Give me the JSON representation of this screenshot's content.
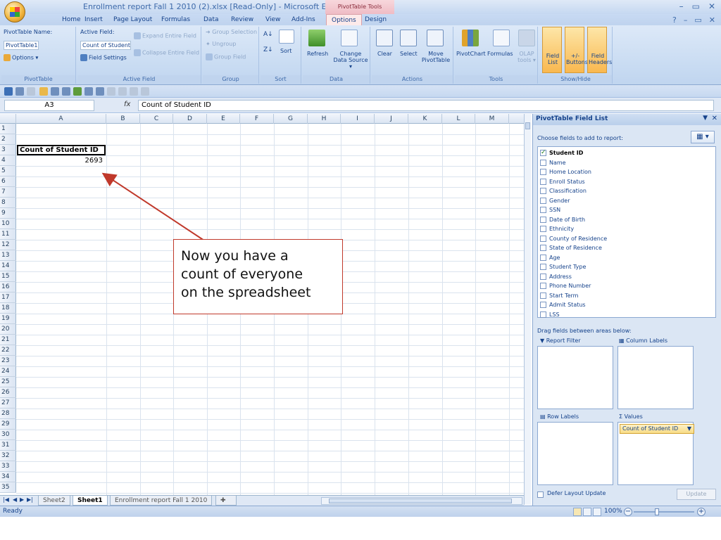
{
  "window": {
    "title": "Enrollment report Fall 1 2010 (2).xlsx  [Read-Only]  -  Microsoft Excel",
    "contextual_header": "PivotTable Tools",
    "controls": [
      "–",
      "▭",
      "✕"
    ],
    "mdi_controls": [
      "?",
      "–",
      "▭",
      "✕"
    ]
  },
  "tabs": [
    {
      "label": "Home"
    },
    {
      "label": "Insert"
    },
    {
      "label": "Page Layout"
    },
    {
      "label": "Formulas"
    },
    {
      "label": "Data"
    },
    {
      "label": "Review"
    },
    {
      "label": "View"
    },
    {
      "label": "Add-Ins"
    },
    {
      "label": "Options"
    },
    {
      "label": "Design"
    }
  ],
  "ribbon": {
    "pivottable": {
      "name_label": "PivotTable Name:",
      "name_value": "PivotTable1",
      "options_label": "Options ▾",
      "group_label": "PivotTable"
    },
    "active_field": {
      "label": "Active Field:",
      "value": "Count of Student",
      "settings_label": "Field Settings",
      "expand_label": "Expand Entire Field",
      "collapse_label": "Collapse Entire Field",
      "group_label": "Active Field"
    },
    "group": {
      "selection_label": "Group Selection",
      "ungroup_label": "Ungroup",
      "field_label": "Group Field",
      "group_label": "Group"
    },
    "sort": {
      "sort_label": "Sort",
      "group_label": "Sort"
    },
    "data": {
      "refresh_label": "Refresh",
      "change_source_label": "Change Data Source ▾",
      "group_label": "Data"
    },
    "actions": {
      "clear_label": "Clear",
      "select_label": "Select",
      "move_label": "Move PivotTable",
      "group_label": "Actions"
    },
    "tools": {
      "pivotchart_label": "PivotChart",
      "formulas_label": "Formulas",
      "olap_label": "OLAP tools ▾",
      "group_label": "Tools"
    },
    "show_hide": {
      "field_list_label": "Field List",
      "buttons_label": "+/- Buttons",
      "headers_label": "Field Headers",
      "group_label": "Show/Hide"
    }
  },
  "formula_bar": {
    "name_box": "A3",
    "fx": "fx",
    "formula": "Count of Student ID"
  },
  "grid": {
    "columns": [
      "A",
      "B",
      "C",
      "D",
      "E",
      "F",
      "G",
      "H",
      "I",
      "J",
      "K",
      "L",
      "M"
    ],
    "rows": [
      "1",
      "2",
      "3",
      "4",
      "5",
      "6",
      "7",
      "8",
      "9",
      "10",
      "11",
      "12",
      "13",
      "14",
      "15",
      "16",
      "17",
      "18",
      "19",
      "20",
      "21",
      "22",
      "23",
      "24",
      "25",
      "26",
      "27",
      "28",
      "29",
      "30",
      "31",
      "32",
      "33",
      "34",
      "35"
    ],
    "cell_a3": "Count of Student ID",
    "cell_a4": "2693"
  },
  "callout": {
    "line1": "Now you have a",
    "line2": "count of everyone",
    "line3": "on the spreadsheet",
    "border_color": "#c0392b",
    "arrow_color": "#c0392b"
  },
  "sheet_tabs": [
    {
      "label": "Sheet2",
      "active": false
    },
    {
      "label": "Sheet1",
      "active": true
    },
    {
      "label": "Enrollment report Fall 1 2010",
      "active": false
    }
  ],
  "status": {
    "ready": "Ready",
    "zoom": "100%"
  },
  "field_list": {
    "title": "PivotTable Field List",
    "choose_label": "Choose fields to add to report:",
    "fields": [
      {
        "name": "Student ID",
        "checked": true
      },
      {
        "name": "Name",
        "checked": false
      },
      {
        "name": "Home Location",
        "checked": false
      },
      {
        "name": "Enroll Status",
        "checked": false
      },
      {
        "name": "Classification",
        "checked": false
      },
      {
        "name": "Gender",
        "checked": false
      },
      {
        "name": "SSN",
        "checked": false
      },
      {
        "name": "Date of Birth",
        "checked": false
      },
      {
        "name": "Ethnicity",
        "checked": false
      },
      {
        "name": "County of Residence",
        "checked": false
      },
      {
        "name": "State of Residence",
        "checked": false
      },
      {
        "name": "Age",
        "checked": false
      },
      {
        "name": "Student Type",
        "checked": false
      },
      {
        "name": "Address",
        "checked": false
      },
      {
        "name": "Phone Number",
        "checked": false
      },
      {
        "name": "Start Term",
        "checked": false
      },
      {
        "name": "Admit Status",
        "checked": false
      },
      {
        "name": "LSS",
        "checked": false
      }
    ],
    "drag_label": "Drag fields between areas below:",
    "report_filter": "Report Filter",
    "column_labels": "Column Labels",
    "row_labels": "Row Labels",
    "values": "Values",
    "values_field": "Count of Student ID",
    "defer_label": "Defer Layout Update",
    "update_label": "Update"
  }
}
